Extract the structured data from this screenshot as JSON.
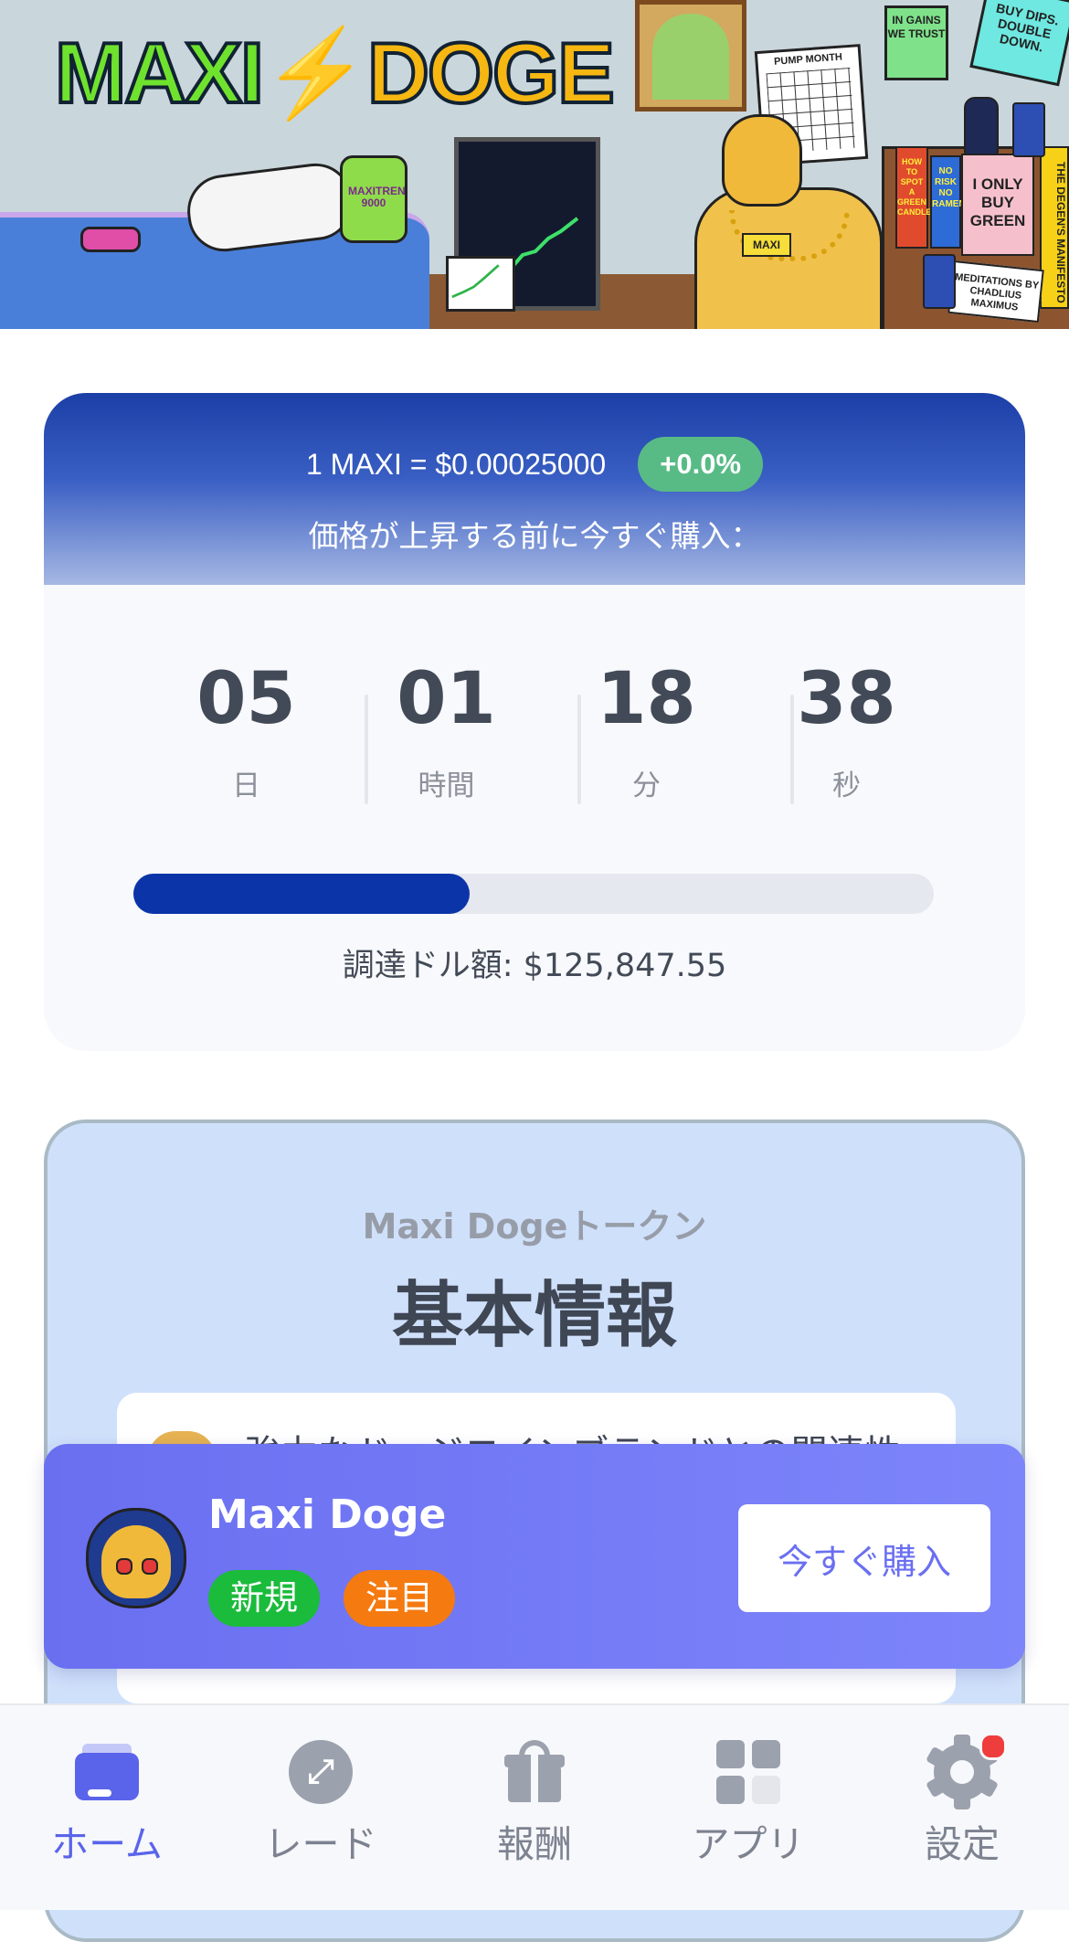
{
  "hero": {
    "logo_maxi": "MAXI",
    "logo_doge": "DOGE",
    "jar_label": "MAXITREN 9000",
    "calendar_title": "PUMP MONTH",
    "sticky_trust": "IN GAINS WE TRUST",
    "sticky_dips": "BUY DIPS. DOUBLE DOWN.",
    "doge_tag": "MAXI",
    "book_green": "I ONLY BUY GREEN",
    "book_manifesto": "THE DEGEN'S MANIFESTO",
    "book_meditations": "MEDITATIONS BY CHADLIUS MAXIMUS",
    "book_spot": "HOW TO SPOT A GREEN CANDLE",
    "book_risk": "NO RISK NO RAMEN"
  },
  "price": {
    "rate_text": "1 MAXI  = $0.00025000",
    "change_badge": "+0.0%",
    "subtitle": "価格が上昇する前に今すぐ購入：",
    "countdown": [
      {
        "value": "05",
        "label": "日"
      },
      {
        "value": "01",
        "label": "時間"
      },
      {
        "value": "18",
        "label": "分"
      },
      {
        "value": "38",
        "label": "秒"
      }
    ],
    "progress_fraction": 0.42,
    "raised_text": "調達ドル額: $125,847.55"
  },
  "info": {
    "kicker": "Maxi Dogeトークン",
    "title": "基本情報",
    "first_item": "強力なドージコインブランドとの関連性"
  },
  "promo": {
    "name": "Maxi Doge",
    "tag_new": "新規",
    "tag_hot": "注目",
    "buy_label": "今すぐ購入"
  },
  "nav": {
    "items": [
      {
        "label": "ホーム",
        "icon": "wallet-card-icon",
        "active": true
      },
      {
        "label": "レード",
        "icon": "trade-arrows-icon",
        "active": false
      },
      {
        "label": "報酬",
        "icon": "gift-icon",
        "active": false
      },
      {
        "label": "アプリ",
        "icon": "apps-grid-icon",
        "active": false
      },
      {
        "label": "設定",
        "icon": "gear-icon",
        "active": false,
        "badge": true
      }
    ]
  },
  "colors": {
    "accent": "#5a64ea",
    "progress": "#0b34a8",
    "badge_green": "#58bb86",
    "tag_new": "#1bbb3c",
    "tag_hot": "#f57a10",
    "notify": "#ef3c3c"
  }
}
